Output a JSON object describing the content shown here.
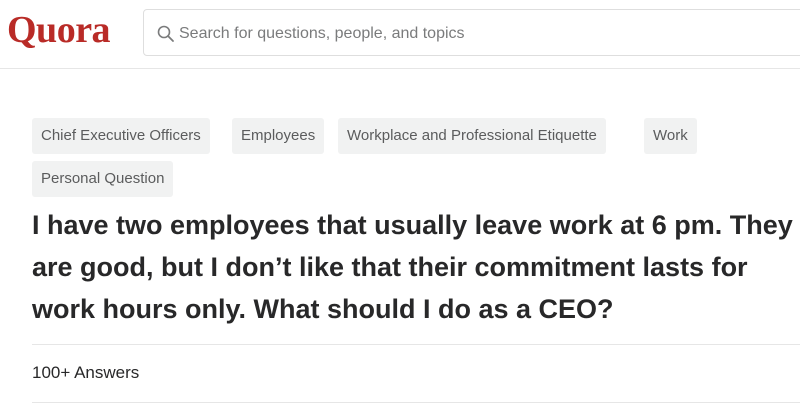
{
  "header": {
    "logo": "Quora",
    "search_placeholder": "Search for questions, people, and topics"
  },
  "topics": [
    "Chief Executive Officers",
    "Employees",
    "Workplace and Professional Etiquette",
    "Work",
    "Personal Question"
  ],
  "question": {
    "title": "I have two employees that usually leave work at 6 pm. They are good, but I don’t like that their commitment lasts for work hours only. What should I do as a CEO?",
    "answers_count": "100+ Answers"
  },
  "colors": {
    "brand": "#b92b27",
    "text": "#282829",
    "chip_bg": "#f1f2f2",
    "chip_text": "#5b5c5d"
  }
}
